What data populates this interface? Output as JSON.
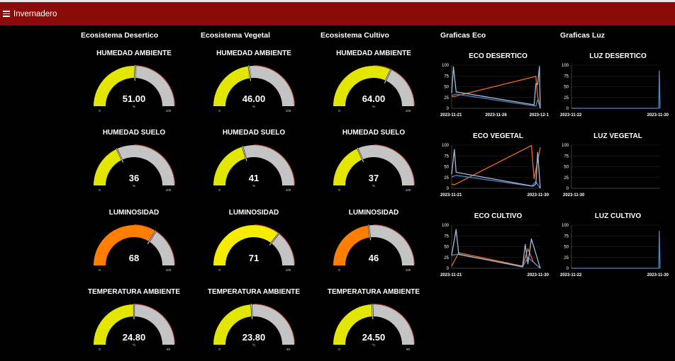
{
  "header": {
    "title": "Invernadero",
    "menu_icon": "hamburger-menu-icon",
    "bg": "#8b0a0a"
  },
  "columns": [
    {
      "title": "Ecosistema Desertico"
    },
    {
      "title": "Ecosistema Vegetal"
    },
    {
      "title": "Ecosistema Cultivo"
    },
    {
      "title": "Graficas Eco"
    },
    {
      "title": "Graficas Luz"
    }
  ],
  "gauges": [
    {
      "label": "HUMEDAD AMBIENTE",
      "value": "51.00",
      "fraction": 0.51,
      "unit": "%",
      "min": "0",
      "max": "100",
      "color": "#e2e600"
    },
    {
      "label": "HUMEDAD AMBIENTE",
      "value": "46.00",
      "fraction": 0.46,
      "unit": "%",
      "min": "0",
      "max": "100",
      "color": "#e2e600"
    },
    {
      "label": "HUMEDAD AMBIENTE",
      "value": "64.00",
      "fraction": 0.64,
      "unit": "%",
      "min": "0",
      "max": "100",
      "color": "#e2e600"
    },
    {
      "label": "HUMEDAD SUELO",
      "value": "36",
      "fraction": 0.36,
      "unit": "%",
      "min": "0",
      "max": "100",
      "color": "#e2e600"
    },
    {
      "label": "HUMEDAD SUELO",
      "value": "41",
      "fraction": 0.41,
      "unit": "%",
      "min": "0",
      "max": "100",
      "color": "#e2e600"
    },
    {
      "label": "HUMEDAD SUELO",
      "value": "37",
      "fraction": 0.37,
      "unit": "%",
      "min": "0",
      "max": "100",
      "color": "#e2e600"
    },
    {
      "label": "LUMINOSIDAD",
      "value": "68",
      "fraction": 0.68,
      "unit": "",
      "min": "0",
      "max": "100",
      "color": "#ff7e00"
    },
    {
      "label": "LUMINOSIDAD",
      "value": "71",
      "fraction": 0.71,
      "unit": "",
      "min": "0",
      "max": "100",
      "color": "#f5ec00"
    },
    {
      "label": "LUMINOSIDAD",
      "value": "46",
      "fraction": 0.46,
      "unit": "",
      "min": "0",
      "max": "100",
      "color": "#ff7e00"
    },
    {
      "label": "TEMPERATURA AMBIENTE",
      "value": "24.80",
      "fraction": 0.5,
      "unit": "°C",
      "min": "0",
      "max": "50",
      "color": "#e2e600"
    },
    {
      "label": "TEMPERATURA AMBIENTE",
      "value": "23.80",
      "fraction": 0.48,
      "unit": "°C",
      "min": "0",
      "max": "50",
      "color": "#e2e600"
    },
    {
      "label": "TEMPERATURA AMBIENTE",
      "value": "24.50",
      "fraction": 0.49,
      "unit": "°C",
      "min": "0",
      "max": "50",
      "color": "#e2e600"
    }
  ],
  "chart_data": [
    {
      "type": "line",
      "title": "ECO DESERTICO",
      "ylim": [
        0,
        100
      ],
      "yticks": [
        0,
        25,
        50,
        75,
        100
      ],
      "x_labels": [
        "2023-11-21",
        "2023-11-26",
        "2023-12-1"
      ],
      "series": [
        {
          "color": "#ef6c1d",
          "x": [
            0,
            0.02,
            0.95,
            0.97,
            1.0
          ],
          "y": [
            28,
            27,
            74,
            28,
            0
          ]
        },
        {
          "color": "#4a86c8",
          "x": [
            0,
            0.05,
            0.95,
            0.97,
            1.0
          ],
          "y": [
            30,
            33,
            5,
            20,
            0
          ]
        },
        {
          "color": "#a8b8d8",
          "x": [
            0,
            0.02,
            0.05,
            0.93,
            0.95,
            0.97,
            0.99,
            1.0
          ],
          "y": [
            35,
            96,
            38,
            8,
            57,
            55,
            97,
            0
          ]
        }
      ]
    },
    {
      "type": "line",
      "title": "LUZ DESERTICO",
      "ylim": [
        0,
        100
      ],
      "yticks": [
        0,
        25,
        50,
        75,
        100
      ],
      "x_labels": [
        "2023-11-22",
        "2023-11-30"
      ],
      "series": [
        {
          "color": "#4a86c8",
          "x": [
            0,
            0.985,
            0.99,
            1.0
          ],
          "y": [
            0,
            0,
            87,
            0
          ]
        }
      ]
    },
    {
      "type": "line",
      "title": "ECO VEGETAL",
      "ylim": [
        0,
        100
      ],
      "yticks": [
        0,
        25,
        50,
        75,
        100
      ],
      "x_labels": [
        "2023-11-21",
        "2023-11-30"
      ],
      "series": [
        {
          "color": "#ef6c1d",
          "x": [
            0,
            0.03,
            0.9,
            0.93,
            1.0
          ],
          "y": [
            10,
            8,
            99,
            22,
            95
          ]
        },
        {
          "color": "#4a86c8",
          "x": [
            0,
            0.05,
            0.9,
            0.95,
            1.0
          ],
          "y": [
            26,
            30,
            5,
            15,
            0
          ]
        },
        {
          "color": "#a8b8d8",
          "x": [
            0,
            0.03,
            0.05,
            0.92,
            0.95,
            0.97,
            1.0
          ],
          "y": [
            32,
            90,
            37,
            5,
            10,
            83,
            0
          ]
        }
      ]
    },
    {
      "type": "line",
      "title": "LUZ VEGETAL",
      "ylim": [
        0,
        100
      ],
      "yticks": [
        0,
        25,
        50,
        75,
        100
      ],
      "x_labels": [
        "2023-11-30"
      ],
      "series": []
    },
    {
      "type": "line",
      "title": "ECO CULTIVO",
      "ylim": [
        0,
        100
      ],
      "yticks": [
        0,
        25,
        50,
        75,
        100
      ],
      "x_labels": [
        "2023-11-21",
        "2023-11-30"
      ],
      "series": [
        {
          "color": "#ef6c1d",
          "x": [
            0,
            0.08,
            0.8,
            0.86,
            0.92,
            1.0
          ],
          "y": [
            5,
            36,
            5,
            45,
            15,
            0
          ]
        },
        {
          "color": "#4a86c8",
          "x": [
            0,
            0.08,
            0.8,
            0.86,
            1.0
          ],
          "y": [
            30,
            33,
            3,
            25,
            0
          ]
        },
        {
          "color": "#a8b8d8",
          "x": [
            0,
            0.05,
            0.08,
            0.8,
            0.83,
            0.86,
            0.9,
            1.0
          ],
          "y": [
            30,
            90,
            32,
            4,
            55,
            10,
            68,
            0
          ]
        }
      ]
    },
    {
      "type": "line",
      "title": "LUZ CULTIVO",
      "ylim": [
        0,
        100
      ],
      "yticks": [
        0,
        25,
        50,
        75,
        100
      ],
      "x_labels": [
        "2023-11-22",
        "2023-11-30"
      ],
      "series": [
        {
          "color": "#4a86c8",
          "x": [
            0,
            0.985,
            0.99,
            1.0
          ],
          "y": [
            0,
            0,
            86,
            0
          ]
        }
      ]
    }
  ]
}
